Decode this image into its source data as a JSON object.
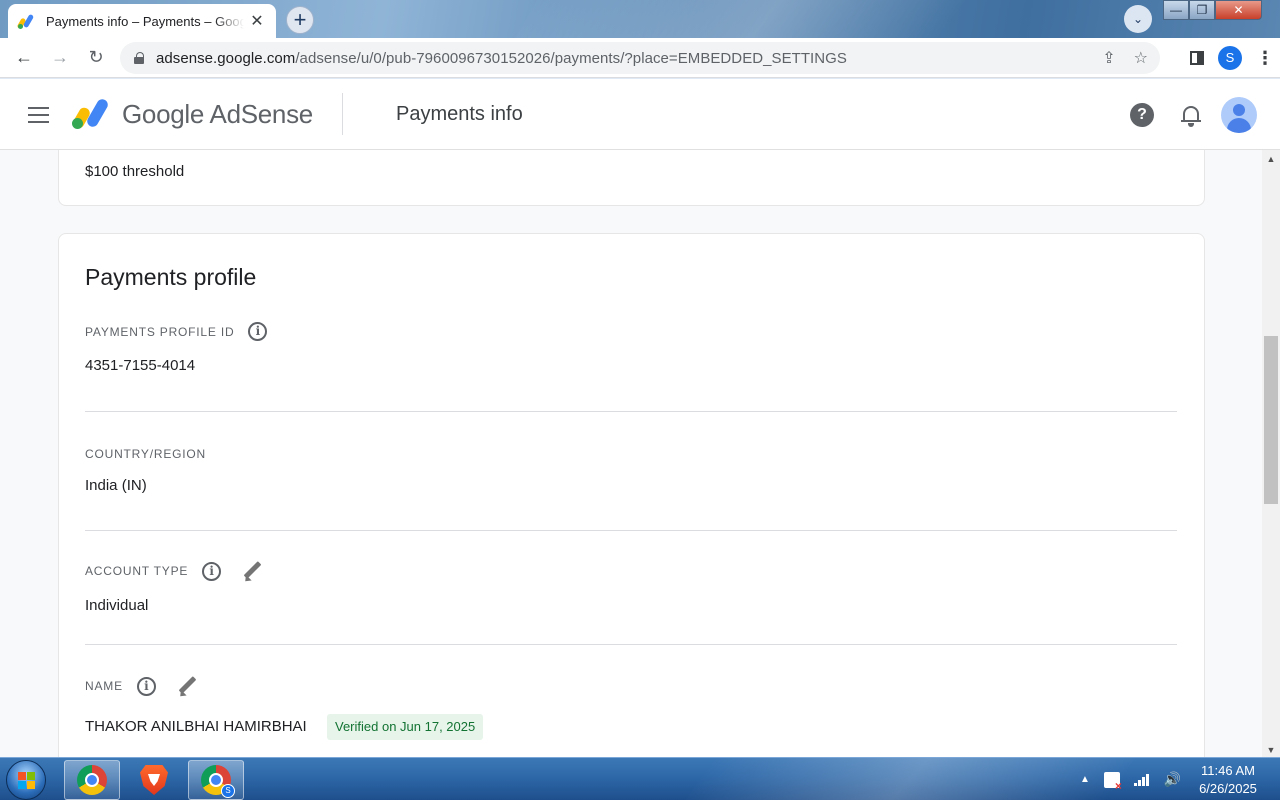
{
  "browser": {
    "tab_title": "Payments info – Payments – Google AdSense",
    "tab_close": "✕",
    "new_tab": "+",
    "tab_search": "⌄",
    "window_min": "—",
    "window_max": "❐",
    "window_close": "✕",
    "url_host": "adsense.google.com",
    "url_path": "/adsense/u/0/pub-7960096730152026/payments/?place=EMBEDDED_SETTINGS",
    "profile_initial": "S"
  },
  "header": {
    "product_name": "Google AdSense",
    "page_title": "Payments info",
    "help_glyph": "?"
  },
  "threshold_card": {
    "threshold_text": "$100 threshold"
  },
  "payments_profile": {
    "title": "Payments profile",
    "fields": [
      {
        "label": "PAYMENTS PROFILE ID",
        "value": "4351-7155-4014",
        "has_info": true,
        "editable": false
      },
      {
        "label": "COUNTRY/REGION",
        "value": "India (IN)",
        "has_info": false,
        "editable": false
      },
      {
        "label": "ACCOUNT TYPE",
        "value": "Individual",
        "has_info": true,
        "editable": true
      },
      {
        "label": "NAME",
        "value": "THAKOR ANILBHAI HAMIRBHAI",
        "has_info": true,
        "editable": true
      }
    ],
    "verified_badge": "Verified on Jun 17, 2025",
    "info_glyph": "i"
  },
  "taskbar": {
    "chrome_profile_initial": "S",
    "time": "11:46 AM",
    "date": "6/26/2025"
  },
  "colors": {
    "adsense_yellow": "#fbbc04",
    "adsense_blue": "#4285f4",
    "adsense_green": "#34a853",
    "verified_bg": "#e6f4ea",
    "verified_text": "#137333"
  },
  "icons": {
    "back": "back-arrow-icon",
    "forward": "forward-arrow-icon",
    "reload": "reload-icon",
    "lock": "lock-icon",
    "share": "share-icon",
    "bookmark": "star-icon",
    "side_panel": "side-panel-icon",
    "menu": "kebab-menu-icon",
    "hamburger": "hamburger-menu-icon",
    "help": "help-icon",
    "notifications": "bell-icon",
    "info": "info-icon",
    "edit": "pencil-icon"
  }
}
